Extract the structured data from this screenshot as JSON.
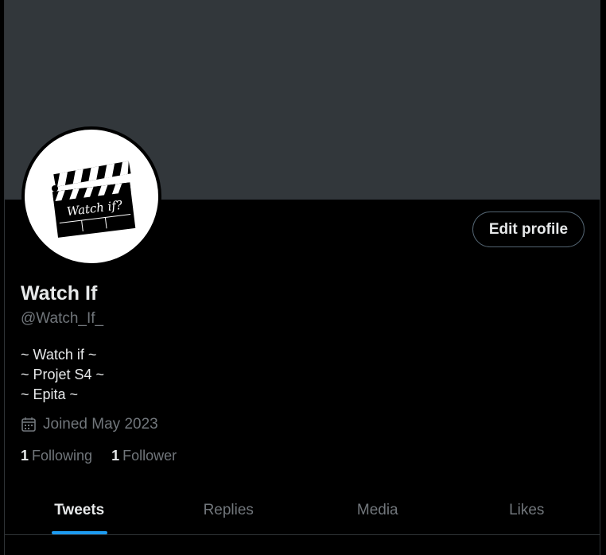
{
  "profile": {
    "name": "Watch If",
    "handle": "@Watch_If_",
    "bio": [
      "~ Watch if ~",
      "~ Projet S4 ~",
      "~ Epita ~"
    ],
    "joined": "Joined May 2023",
    "avatar_text": "Watch if?",
    "edit_label": "Edit profile"
  },
  "stats": {
    "following_count": "1",
    "following_label": "Following",
    "followers_count": "1",
    "followers_label": "Follower"
  },
  "tabs": [
    {
      "label": "Tweets",
      "active": true
    },
    {
      "label": "Replies",
      "active": false
    },
    {
      "label": "Media",
      "active": false
    },
    {
      "label": "Likes",
      "active": false
    }
  ],
  "colors": {
    "banner": "#32373b",
    "accent": "#1d9bf0",
    "text_primary": "#e7e9ea",
    "text_secondary": "#71767b",
    "border": "#2f3336"
  },
  "icons": {
    "joined": "calendar-icon"
  }
}
